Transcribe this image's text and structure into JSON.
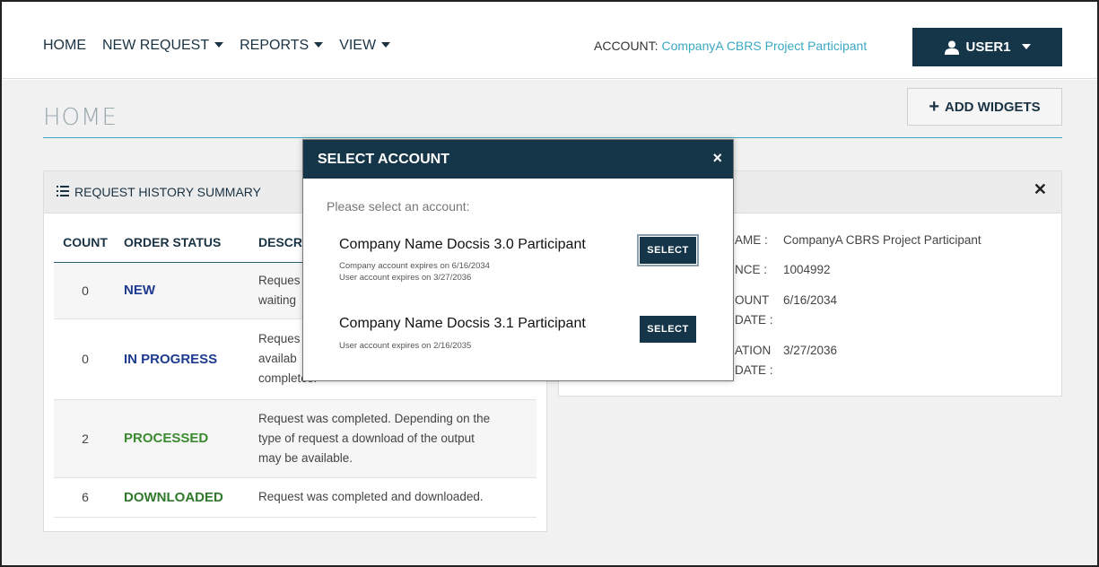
{
  "nav": {
    "items": [
      {
        "label": "HOME",
        "dropdown": false
      },
      {
        "label": "NEW REQUEST",
        "dropdown": true
      },
      {
        "label": "REPORTS",
        "dropdown": true
      },
      {
        "label": "VIEW",
        "dropdown": true
      }
    ],
    "account_label": "ACCOUNT:",
    "account_name": "CompanyA CBRS Project Participant",
    "user_label": "USER1"
  },
  "page": {
    "title": "HOME",
    "add_widgets": "ADD WIDGETS"
  },
  "request_history": {
    "title": "REQUEST HISTORY SUMMARY",
    "columns": [
      "COUNT",
      "ORDER STATUS",
      "DESCR"
    ],
    "rows": [
      {
        "count": "0",
        "status": "NEW",
        "desc": [
          "Reques",
          "waiting"
        ]
      },
      {
        "count": "0",
        "status": "IN PROGRESS",
        "desc": [
          "Reques",
          "availab",
          "completes."
        ]
      },
      {
        "count": "2",
        "status": "PROCESSED",
        "desc": [
          "Request was completed. Depending on the",
          "type of request a download of the output",
          "may be available."
        ]
      },
      {
        "count": "6",
        "status": "DOWNLOADED",
        "desc": [
          "Request was completed and downloaded."
        ]
      }
    ]
  },
  "account_panel": {
    "rows": [
      {
        "label": "AME :",
        "value": "CompanyA CBRS Project Participant"
      },
      {
        "label": "NCE :",
        "value": "1004992"
      },
      {
        "label": "OUNT",
        "label2": "DATE :",
        "value": "6/16/2034"
      },
      {
        "label": "ATION",
        "label2": "DATE :",
        "value": "3/27/2036"
      }
    ]
  },
  "modal": {
    "title": "SELECT ACCOUNT",
    "close": "×",
    "prompt": "Please select an account:",
    "options": [
      {
        "name": "Company Name Docsis 3.0 Participant",
        "details": [
          "Company account expires on 6/16/2034",
          "User account expires on 3/27/2036"
        ],
        "button": "SELECT"
      },
      {
        "name": "Company Name Docsis 3.1 Participant",
        "details": [
          "User account expires on 2/16/2035"
        ],
        "button": "SELECT"
      }
    ]
  },
  "colors": {
    "navy": "#153648",
    "accent": "#3ba9c2",
    "status_blue": "#1d3b8f",
    "status_green": "#3b8a2f"
  },
  "icons": {
    "user": "user-icon",
    "plus": "plus-icon",
    "list": "list-icon",
    "close": "close-icon"
  }
}
